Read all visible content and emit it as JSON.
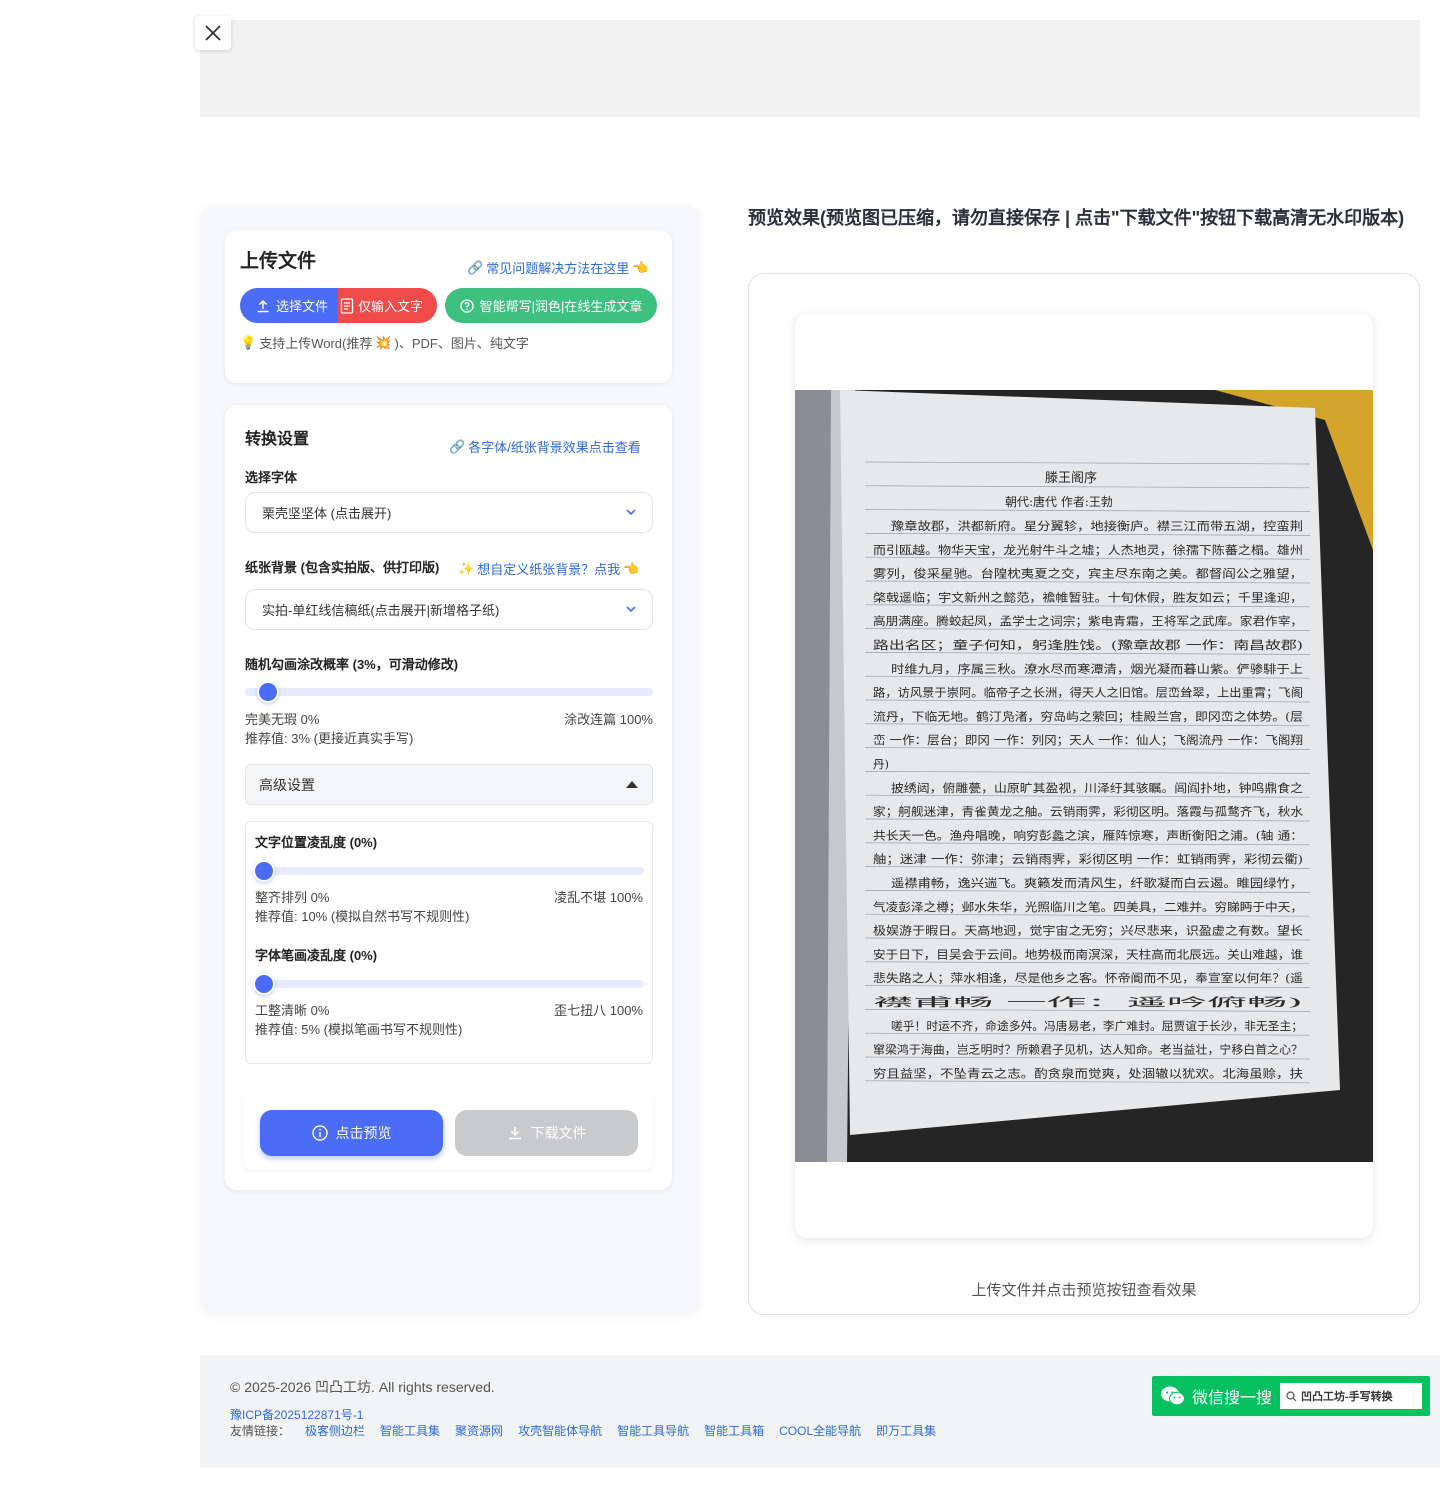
{
  "upload": {
    "title": "上传文件",
    "help_link": "常见问题解决方法在这里",
    "select_file": "选择文件",
    "text_only": "仅输入文字",
    "ai_write": "智能帮写|润色|在线生成文章",
    "support_prefix": "支持上传Word(推荐",
    "support_suffix": ")、PDF、图片、纯文字"
  },
  "settings": {
    "title": "转换设置",
    "effect_link": "各字体/纸张背景效果点击查看",
    "font_label": "选择字体",
    "font_value": "栗壳坚坚体 (点击展开)",
    "paper_label": "纸张背景 (包含实拍版、供打印版)",
    "paper_custom_link": "想自定义纸张背景？点我",
    "paper_value": "实拍-单红线信稿纸(点击展开|新增格子纸)",
    "scribble_label": "随机勾画涂改概率 (3%，可滑动修改)",
    "scribble_value": 0.03,
    "scribble_min": "完美无瑕 0%",
    "scribble_max": "涂改连篇 100%",
    "scribble_rec": "推荐值: 3% (更接近真实手写)",
    "advanced_label": "高级设置",
    "pos_label": "文字位置凌乱度 (0%)",
    "pos_value": 0,
    "pos_min": "整齐排列 0%",
    "pos_max": "凌乱不堪 100%",
    "pos_rec": "推荐值: 10% (模拟自然书写不规则性)",
    "stroke_label": "字体笔画凌乱度 (0%)",
    "stroke_value": 0,
    "stroke_min": "工整清晰 0%",
    "stroke_max": "歪七扭八 100%",
    "stroke_rec": "推荐值: 5% (模拟笔画书写不规则性)",
    "preview_btn": "点击预览",
    "download_btn": "下载文件"
  },
  "preview": {
    "title": "预览效果(预览图已压缩，请勿直接保存 | 点击\"下载文件\"按钮下载高清无水印版本)",
    "caption": "上传文件并点击预览按钮查看效果",
    "handwriting_title": "滕王阁序",
    "handwriting_byline": "朝代:唐代 作者:王勃",
    "handwriting_lines": [
      "豫章故郡，洪都新府。星分翼轸，地接衡庐。襟三江而带五湖，控蛮荆",
      "而引瓯越。物华天宝，龙光射牛斗之墟；人杰地灵，徐孺下陈蕃之榻。雄州",
      "雾列，俊采星驰。台隍枕夷夏之交，宾主尽东南之美。都督阎公之雅望，",
      "棨戟遥临；宇文新州之懿范，襜帷暂驻。十旬休假，胜友如云；千里逢迎，",
      "高朋满座。腾蛟起凤，孟学士之词宗；紫电青霜，王将军之武库。家君作宰，",
      "路出名区；童子何知，躬逢胜饯。(豫章故郡 一作：南昌故郡)",
      "时维九月，序属三秋。潦水尽而寒潭清，烟光凝而暮山紫。俨骖騑于上",
      "路，访风景于崇阿。临帝子之长洲，得天人之旧馆。层峦耸翠，上出重霄；飞阁",
      "流丹，下临无地。鹤汀凫渚，穷岛屿之萦回；桂殿兰宫，即冈峦之体势。(层",
      "峦 一作：层台；即冈 一作：列冈；天人 一作：仙人；飞阁流丹 一作：飞阁翔",
      "丹)",
      "披绣闼，俯雕甍，山原旷其盈视，川泽纡其骇瞩。闾阎扑地，钟鸣鼎食之",
      "家；舸舰迷津，青雀黄龙之舳。云销雨霁，彩彻区明。落霞与孤鹜齐飞，秋水",
      "共长天一色。渔舟唱晚，响穷彭蠡之滨，雁阵惊寒，声断衡阳之浦。(轴 通：",
      "舳；迷津 一作：弥津；云销雨霁，彩彻区明 一作：虹销雨霁，彩彻云衢)",
      "遥襟甫畅，逸兴遄飞。爽籁发而清风生，纤歌凝而白云遏。睢园绿竹，",
      "气凌彭泽之樽；邺水朱华，光照临川之笔。四美具，二难并。穷睇眄于中天，",
      "极娱游于暇日。天高地迥，觉宇宙之无穷；兴尽悲来，识盈虚之有数。望长",
      "安于日下，目吴会于云间。地势极而南溟深，天柱高而北辰远。关山难越，谁",
      "悲失路之人；萍水相逢，尽是他乡之客。怀帝阍而不见，奉宣室以何年？(遥",
      "襟甫畅 一作：遥吟俯畅)",
      "嗟乎！时运不齐，命途多舛。冯唐易老，李广难封。屈贾谊于长沙，非无圣主；",
      "窜梁鸿于海曲，岂乏明时？所赖君子见机，达人知命。老当益壮，宁移白首之心？",
      "穷且益坚，不坠青云之志。酌贪泉而觉爽，处涸辙以犹欢。北海虽赊，扶"
    ]
  },
  "footer": {
    "copyright": "© 2025-2026 凹凸工坊. All rights reserved.",
    "icp": "豫ICP备2025122871号-1",
    "friends_label": "友情链接：",
    "links": [
      "极客侧边栏",
      "智能工具集",
      "聚资源网",
      "攻壳智能体导航",
      "智能工具导航",
      "智能工具箱",
      "COOL全能导航",
      "即万工具集"
    ],
    "wechat_label": "微信搜一搜",
    "wechat_query": "凹凸工坊-手写转换"
  },
  "colors": {
    "accent": "#4a6cf7",
    "red": "#f04a4a",
    "green": "#3ec081",
    "wechat": "#07c160",
    "link": "#2e6ad8"
  }
}
